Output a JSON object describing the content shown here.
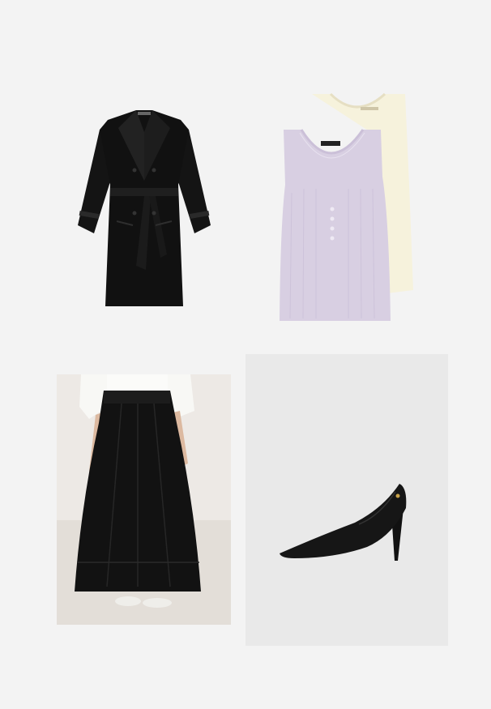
{
  "items": [
    {
      "name": "coat",
      "category": "outerwear",
      "color": "#151515"
    },
    {
      "name": "tank-tops",
      "category": "tops",
      "colors": [
        "#d9d0e2",
        "#f7f3df"
      ]
    },
    {
      "name": "maxi-skirt",
      "category": "skirt",
      "color": "#111111"
    },
    {
      "name": "pumps",
      "category": "shoes",
      "color": "#1a1a1a"
    }
  ]
}
